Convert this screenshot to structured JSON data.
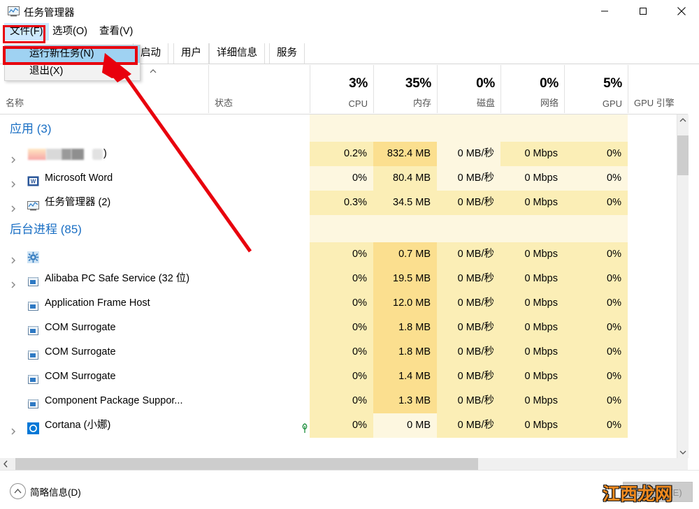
{
  "window": {
    "title": "任务管理器",
    "icon": "task-manager-icon",
    "minimize_label": "─",
    "maximize_label": "□",
    "close_label": "✕"
  },
  "menubar": {
    "items": [
      {
        "label": "文件(F)",
        "name": "menu-file",
        "active": true
      },
      {
        "label": "选项(O)",
        "name": "menu-options",
        "active": false
      },
      {
        "label": "查看(V)",
        "name": "menu-view",
        "active": false
      }
    ]
  },
  "file_menu": {
    "open": true,
    "items": [
      {
        "label": "运行新任务(N)",
        "selected": true
      },
      {
        "label": "退出(X)",
        "selected": false
      }
    ]
  },
  "tabs": [
    {
      "label": "启动",
      "selected": false
    },
    {
      "label": "用户",
      "selected": false
    },
    {
      "label": "详细信息",
      "selected": false
    },
    {
      "label": "服务",
      "selected": false
    }
  ],
  "columns": [
    {
      "key": "name",
      "label": "名称",
      "value": "",
      "align": "left"
    },
    {
      "key": "status",
      "label": "状态",
      "value": "",
      "align": "left"
    },
    {
      "key": "cpu",
      "label": "CPU",
      "value": "3%",
      "align": "right"
    },
    {
      "key": "mem",
      "label": "内存",
      "value": "35%",
      "align": "right"
    },
    {
      "key": "disk",
      "label": "磁盘",
      "value": "0%",
      "align": "right"
    },
    {
      "key": "net",
      "label": "网络",
      "value": "0%",
      "align": "right"
    },
    {
      "key": "gpu",
      "label": "GPU",
      "value": "5%",
      "align": "right"
    },
    {
      "key": "gpueng",
      "label": "GPU 引擎",
      "value": "",
      "align": "left"
    }
  ],
  "groups": [
    {
      "title": "应用 (3)",
      "name": "group-apps"
    },
    {
      "title": "后台进程 (85)",
      "name": "group-background"
    }
  ],
  "rows": [
    {
      "group": "apps",
      "name": "",
      "redacted": true,
      "suffix": ")",
      "icon": "redacted-app-icon",
      "expandable": true,
      "status": "",
      "cpu": "0.2%",
      "mem": "832.4 MB",
      "disk": "0 MB/秒",
      "net": "0 Mbps",
      "gpu": "0%",
      "gpueng": "",
      "heat": {
        "cpu": 2,
        "mem": 3,
        "disk": 1,
        "net": 2,
        "gpu": 2
      }
    },
    {
      "group": "apps",
      "name": "Microsoft Word",
      "redacted": false,
      "suffix": "",
      "icon": "word-icon",
      "expandable": true,
      "status": "",
      "cpu": "0%",
      "mem": "80.4 MB",
      "disk": "0 MB/秒",
      "net": "0 Mbps",
      "gpu": "0%",
      "gpueng": "",
      "heat": {
        "cpu": 1,
        "mem": 2,
        "disk": 1,
        "net": 1,
        "gpu": 1
      }
    },
    {
      "group": "apps",
      "name": "任务管理器 (2)",
      "redacted": false,
      "suffix": "",
      "icon": "task-manager-icon",
      "expandable": true,
      "status": "",
      "cpu": "0.3%",
      "mem": "34.5 MB",
      "disk": "0 MB/秒",
      "net": "0 Mbps",
      "gpu": "0%",
      "gpueng": "",
      "heat": {
        "cpu": 2,
        "mem": 2,
        "disk": 2,
        "net": 2,
        "gpu": 2
      }
    },
    {
      "group": "background",
      "name": "",
      "redacted": false,
      "suffix": "",
      "icon": "settings-gear-icon",
      "expandable": true,
      "status": "",
      "cpu": "0%",
      "mem": "0.7 MB",
      "disk": "0 MB/秒",
      "net": "0 Mbps",
      "gpu": "0%",
      "gpueng": "",
      "heat": {
        "cpu": 2,
        "mem": 3,
        "disk": 2,
        "net": 2,
        "gpu": 2
      }
    },
    {
      "group": "background",
      "name": "Alibaba PC Safe Service (32 位)",
      "redacted": false,
      "suffix": "",
      "icon": "generic-process-icon",
      "expandable": true,
      "status": "",
      "cpu": "0%",
      "mem": "19.5 MB",
      "disk": "0 MB/秒",
      "net": "0 Mbps",
      "gpu": "0%",
      "gpueng": "",
      "heat": {
        "cpu": 2,
        "mem": 3,
        "disk": 2,
        "net": 2,
        "gpu": 2
      }
    },
    {
      "group": "background",
      "name": "Application Frame Host",
      "redacted": false,
      "suffix": "",
      "icon": "generic-process-icon",
      "expandable": false,
      "status": "",
      "cpu": "0%",
      "mem": "12.0 MB",
      "disk": "0 MB/秒",
      "net": "0 Mbps",
      "gpu": "0%",
      "gpueng": "",
      "heat": {
        "cpu": 2,
        "mem": 3,
        "disk": 2,
        "net": 2,
        "gpu": 2
      }
    },
    {
      "group": "background",
      "name": "COM Surrogate",
      "redacted": false,
      "suffix": "",
      "icon": "generic-process-icon",
      "expandable": false,
      "status": "",
      "cpu": "0%",
      "mem": "1.8 MB",
      "disk": "0 MB/秒",
      "net": "0 Mbps",
      "gpu": "0%",
      "gpueng": "",
      "heat": {
        "cpu": 2,
        "mem": 3,
        "disk": 2,
        "net": 2,
        "gpu": 2
      }
    },
    {
      "group": "background",
      "name": "COM Surrogate",
      "redacted": false,
      "suffix": "",
      "icon": "generic-process-icon",
      "expandable": false,
      "status": "",
      "cpu": "0%",
      "mem": "1.8 MB",
      "disk": "0 MB/秒",
      "net": "0 Mbps",
      "gpu": "0%",
      "gpueng": "",
      "heat": {
        "cpu": 2,
        "mem": 3,
        "disk": 2,
        "net": 2,
        "gpu": 2
      }
    },
    {
      "group": "background",
      "name": "COM Surrogate",
      "redacted": false,
      "suffix": "",
      "icon": "generic-process-icon",
      "expandable": false,
      "status": "",
      "cpu": "0%",
      "mem": "1.4 MB",
      "disk": "0 MB/秒",
      "net": "0 Mbps",
      "gpu": "0%",
      "gpueng": "",
      "heat": {
        "cpu": 2,
        "mem": 3,
        "disk": 2,
        "net": 2,
        "gpu": 2
      }
    },
    {
      "group": "background",
      "name": "Component Package Suppor...",
      "redacted": false,
      "suffix": "",
      "icon": "generic-process-icon",
      "expandable": false,
      "status": "",
      "cpu": "0%",
      "mem": "1.3 MB",
      "disk": "0 MB/秒",
      "net": "0 Mbps",
      "gpu": "0%",
      "gpueng": "",
      "heat": {
        "cpu": 2,
        "mem": 3,
        "disk": 2,
        "net": 2,
        "gpu": 2
      }
    },
    {
      "group": "background",
      "name": "Cortana (小娜)",
      "redacted": false,
      "suffix": "",
      "icon": "cortana-icon",
      "expandable": true,
      "status": "leaf-icon",
      "cpu": "0%",
      "mem": "0 MB",
      "disk": "0 MB/秒",
      "net": "0 Mbps",
      "gpu": "0%",
      "gpueng": "",
      "heat": {
        "cpu": 2,
        "mem": 1,
        "disk": 2,
        "net": 2,
        "gpu": 2
      }
    }
  ],
  "statusbar": {
    "fewer_details_label": "简略信息(D)",
    "fewer_details_icon": "chevron-up-icon",
    "end_task_label": "结束任务(E)"
  },
  "watermark": {
    "text": "江西龙网"
  },
  "scrollbars": {
    "vertical_up_icon": "chevron-up-icon",
    "vertical_down_icon": "chevron-down-icon",
    "horizontal_left_icon": "chevron-left-icon",
    "horizontal_right_icon": "chevron-right-icon"
  },
  "colors": {
    "accent_blue": "#1a6fc4",
    "menu_highlight": "#9fd2f2",
    "annotation_red": "#e8000d",
    "watermark_orange": "#f08a1e",
    "heat_1": "#fdf7e0",
    "heat_2": "#fbeeb6",
    "heat_3": "#fbdf8f"
  }
}
